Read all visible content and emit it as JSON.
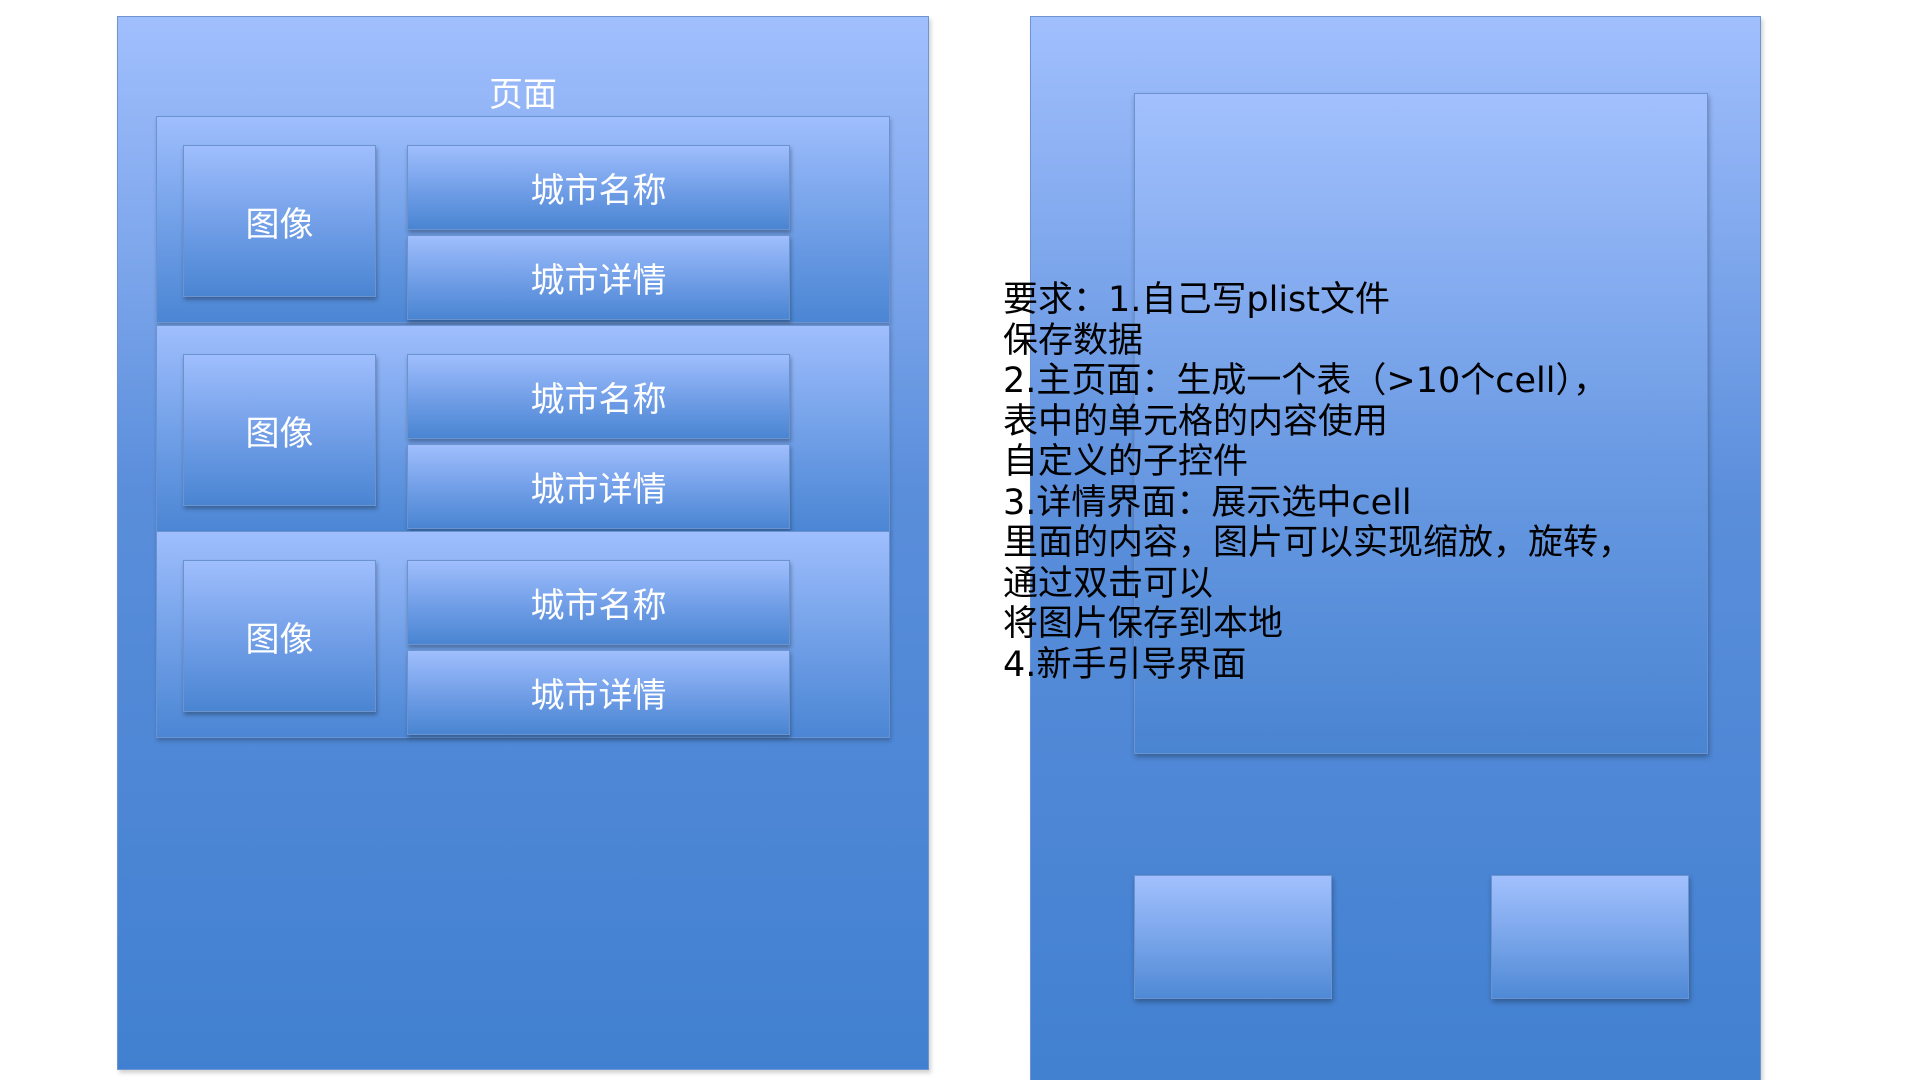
{
  "left_panel": {
    "title": "页面",
    "rows": [
      {
        "image_label": "图像",
        "name_label": "城市名称",
        "detail_label": "城市详情"
      },
      {
        "image_label": "图像",
        "name_label": "城市名称",
        "detail_label": "城市详情"
      },
      {
        "image_label": "图像",
        "name_label": "城市名称",
        "detail_label": "城市详情"
      }
    ]
  },
  "requirements": {
    "lines": [
      "要求：1.自己写plist文件",
      "保存数据",
      "2.主页面：生成一个表（>10个cell），",
      "表中的单元格的内容使用",
      "自定义的子控件",
      "3.详情界面：展示选中cell",
      "里面的内容，图片可以实现缩放，旋转，",
      "通过双击可以",
      "将图片保存到本地",
      "4.新手引导界面"
    ]
  },
  "colors": {
    "gradient_top": "#a1bffd",
    "gradient_bottom": "#4180d0",
    "label_text": "#ffffff",
    "requirement_text": "#000000"
  }
}
